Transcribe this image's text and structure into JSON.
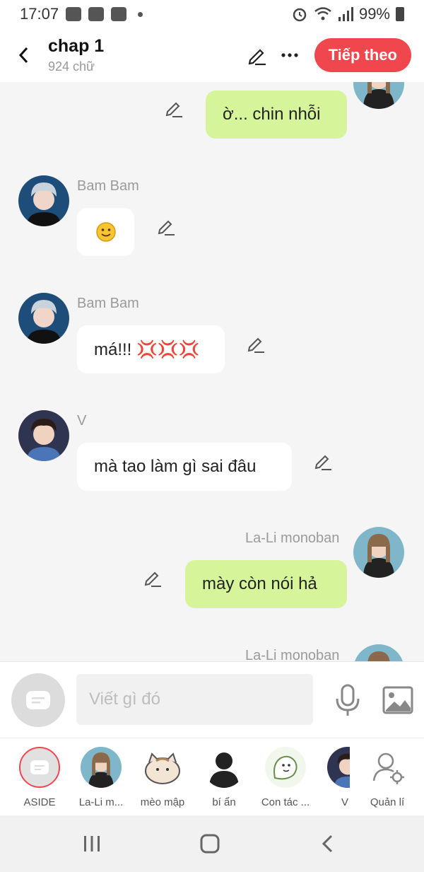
{
  "status": {
    "time": "17:07",
    "battery": "99%"
  },
  "header": {
    "title": "chap 1",
    "word_count": "924 chữ",
    "next_label": "Tiếp theo"
  },
  "messages": [
    {
      "side": "right",
      "sender": "",
      "text": "ờ... chin nhỗi"
    },
    {
      "side": "left",
      "sender": "Bam Bam",
      "text": "🙂"
    },
    {
      "side": "left",
      "sender": "Bam Bam",
      "text": "má!!! 💢💢💢"
    },
    {
      "side": "left",
      "sender": "V",
      "text": "mà tao làm gì sai đâu"
    },
    {
      "side": "right",
      "sender": "La-Li monoban",
      "text": "mày còn nói hả"
    },
    {
      "side": "right",
      "sender": "La-Li monoban",
      "text": ""
    }
  ],
  "composer": {
    "placeholder": "Viết gì đó"
  },
  "characters": [
    {
      "name": "ASIDE"
    },
    {
      "name": "La-Li m..."
    },
    {
      "name": "mèo mập"
    },
    {
      "name": "bí ẩn"
    },
    {
      "name": "Con tác ..."
    },
    {
      "name": "V"
    },
    {
      "name": "Quản lí"
    }
  ],
  "colors": {
    "accent": "#f0474f",
    "own_bubble": "#d6f59a",
    "other_bubble": "#ffffff",
    "background": "#f5f5f5"
  }
}
